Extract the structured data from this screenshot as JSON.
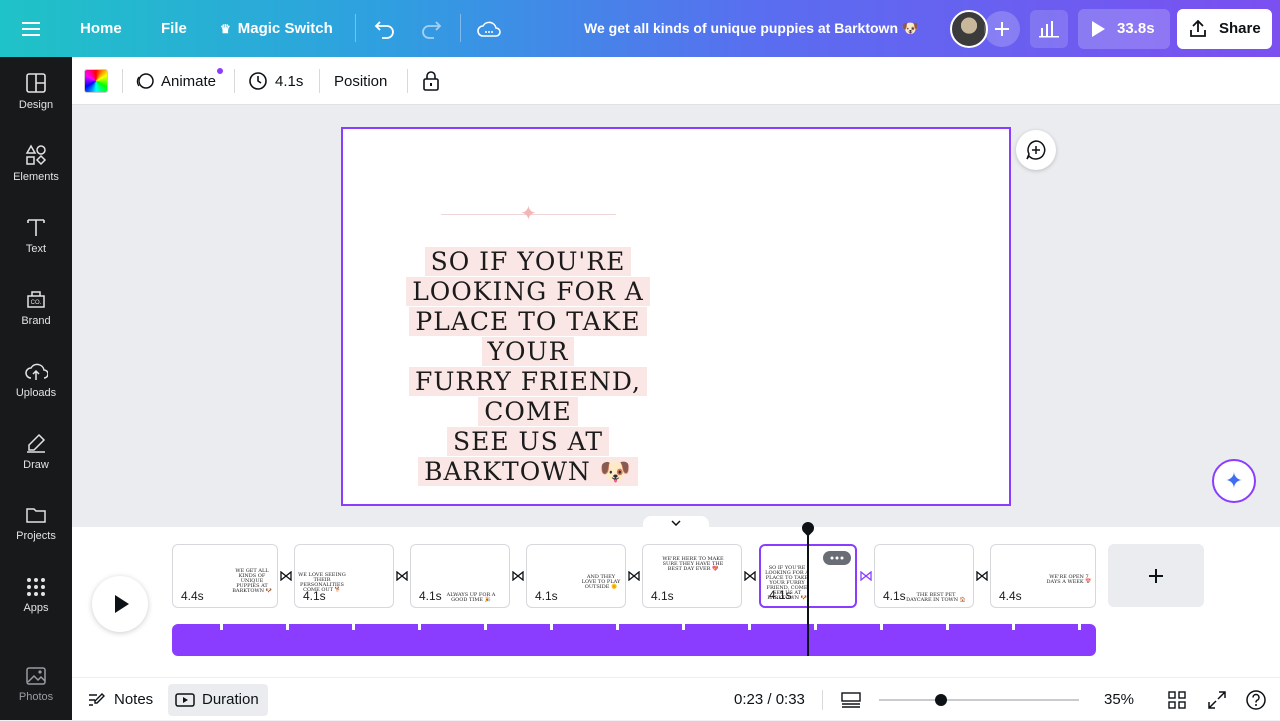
{
  "topbar": {
    "home_label": "Home",
    "file_label": "File",
    "magic_switch_label": "Magic Switch",
    "doc_title": "We get all kinds of unique puppies at Barktown 🐶",
    "play_duration": "33.8s",
    "share_label": "Share",
    "gradient_start": "#1fc3c7",
    "gradient_end": "#7b4ff0"
  },
  "sidebar": {
    "items": [
      {
        "label": "Design",
        "icon": "design-icon"
      },
      {
        "label": "Elements",
        "icon": "elements-icon"
      },
      {
        "label": "Text",
        "icon": "text-icon"
      },
      {
        "label": "Brand",
        "icon": "brand-icon"
      },
      {
        "label": "Uploads",
        "icon": "uploads-icon"
      },
      {
        "label": "Draw",
        "icon": "draw-icon"
      },
      {
        "label": "Projects",
        "icon": "projects-icon"
      },
      {
        "label": "Apps",
        "icon": "apps-icon"
      },
      {
        "label": "Photos",
        "icon": "photos-icon"
      }
    ]
  },
  "toolbar": {
    "animate_label": "Animate",
    "duration_label": "4.1s",
    "position_label": "Position"
  },
  "slide": {
    "text_lines": [
      "SO IF YOU'RE",
      "LOOKING FOR A",
      "PLACE TO TAKE YOUR",
      "FURRY FRIEND, COME",
      "SEE US AT",
      "BARKTOWN 🐶"
    ]
  },
  "timeline": {
    "pages": [
      {
        "duration": "4.4s",
        "preview": "WE GET ALL KINDS OF UNIQUE PUPPIES AT BARKTOWN 🐶"
      },
      {
        "duration": "4.1s",
        "preview": "WE LOVE SEEING THEIR PERSONALITIES COME OUT 🐕"
      },
      {
        "duration": "4.1s",
        "preview": "ALWAYS UP FOR A GOOD TIME 🎉"
      },
      {
        "duration": "4.1s",
        "preview": "AND THEY LOVE TO PLAY OUTSIDE 🌞"
      },
      {
        "duration": "4.1s",
        "preview": "WE'RE HERE TO MAKE SURE THEY HAVE THE BEST DAY EVER 💖"
      },
      {
        "duration": "4.1s",
        "preview": "SO IF YOU'RE LOOKING FOR A PLACE TO TAKE YOUR FURRY FRIEND, COME SEE US AT BARKTOWN 🐶"
      },
      {
        "duration": "4.1s",
        "preview": "THE BEST PET DAYCARE IN TOWN 🏠"
      },
      {
        "duration": "4.4s",
        "preview": "WE'RE OPEN 7 DAYS A WEEK 📅"
      }
    ],
    "accent": "#8b3dff"
  },
  "bottombar": {
    "notes_label": "Notes",
    "duration_label": "Duration",
    "time_readout": "0:23 / 0:33",
    "zoom_label": "35%",
    "zoom_fraction": 0.35
  }
}
